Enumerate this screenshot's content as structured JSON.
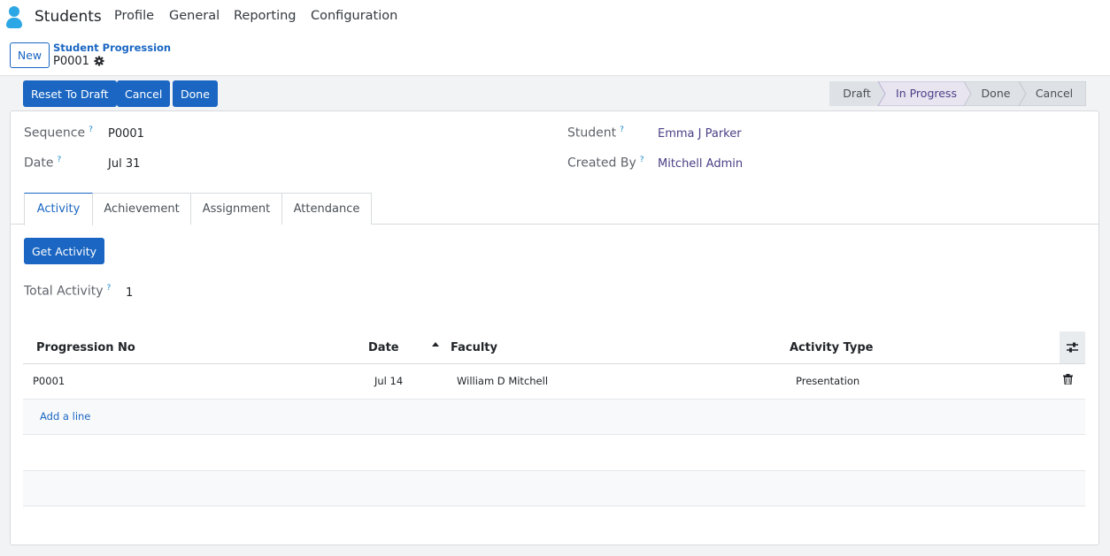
{
  "navbar": {
    "app_name": "Students",
    "menu": [
      "Profile",
      "General",
      "Reporting",
      "Configuration"
    ]
  },
  "control_panel": {
    "new_label": "New",
    "breadcrumb_parent": "Student Progression",
    "breadcrumb_current": "P0001"
  },
  "actions": {
    "reset": "Reset To Draft",
    "cancel": "Cancel",
    "done": "Done"
  },
  "statusbar": {
    "stages": [
      "Draft",
      "In Progress",
      "Done",
      "Cancel"
    ],
    "current": "In Progress"
  },
  "form": {
    "sequence_label": "Sequence",
    "sequence_value": "P0001",
    "date_label": "Date",
    "date_value": "Jul 31",
    "student_label": "Student",
    "student_value": "Emma J Parker",
    "created_by_label": "Created By",
    "created_by_value": "Mitchell Admin",
    "help_mark": "?"
  },
  "tabs": [
    "Activity",
    "Achievement",
    "Assignment",
    "Attendance"
  ],
  "activity": {
    "get_button": "Get Activity",
    "total_label": "Total Activity",
    "total_value": "1"
  },
  "table": {
    "columns": [
      "Progression No",
      "Date",
      "Faculty",
      "Activity Type"
    ],
    "rows": [
      {
        "progression_no": "P0001",
        "date": "Jul 14",
        "faculty": "William D Mitchell",
        "activity_type": "Presentation"
      }
    ],
    "add_line": "Add a line"
  }
}
